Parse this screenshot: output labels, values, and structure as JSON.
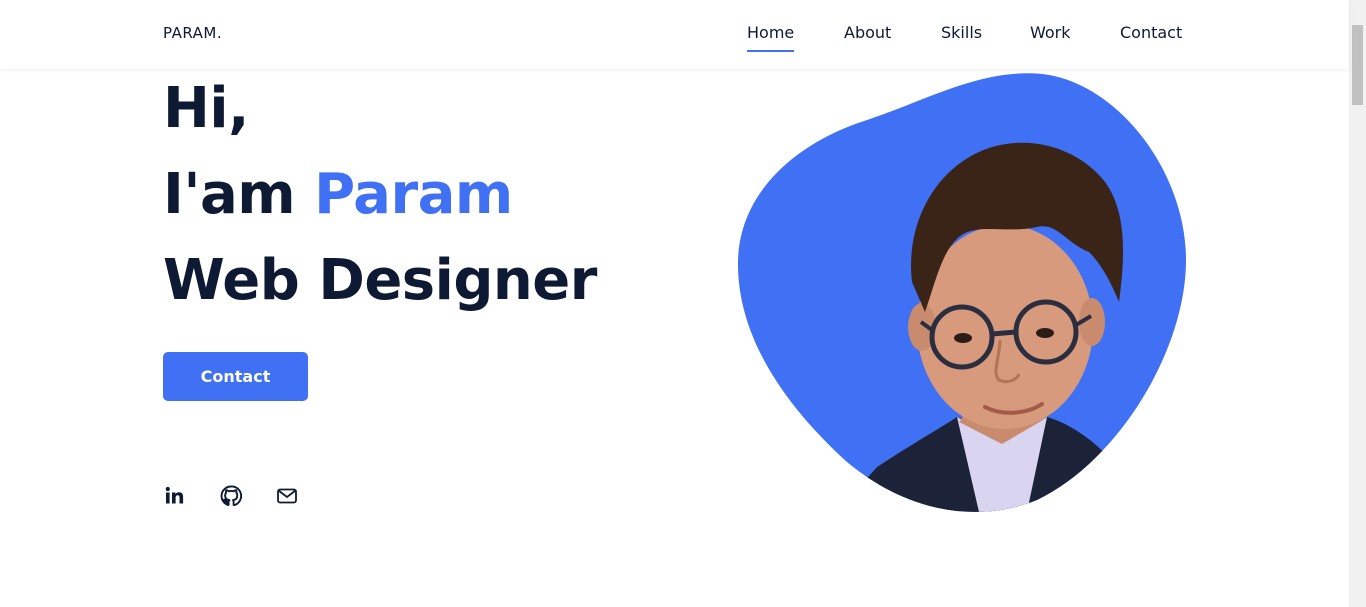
{
  "brand": {
    "logo": "PARAM."
  },
  "nav": {
    "items": [
      {
        "label": "Home",
        "active": true
      },
      {
        "label": "About",
        "active": false
      },
      {
        "label": "Skills",
        "active": false
      },
      {
        "label": "Work",
        "active": false
      },
      {
        "label": "Contact",
        "active": false
      }
    ]
  },
  "hero": {
    "greeting": "Hi,",
    "intro_prefix": "I'am ",
    "name": "Param",
    "role": "Web Designer",
    "cta_label": "Contact"
  },
  "social": {
    "items": [
      {
        "icon": "linkedin-icon"
      },
      {
        "icon": "github-icon"
      },
      {
        "icon": "mail-icon"
      }
    ]
  },
  "colors": {
    "accent": "#4070f4",
    "text": "#0e1a33",
    "background": "#ffffff"
  }
}
